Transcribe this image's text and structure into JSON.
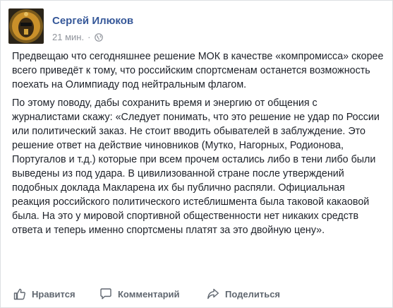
{
  "post": {
    "author": "Сергей Илюков",
    "time": "21 мин.",
    "separator": "·",
    "privacy_icon": "globe-icon",
    "paragraphs": [
      "Предвещаю что сегодняшнее решение МОК в качестве «компромисса» скорее всего приведёт к тому, что российским спортсменам останется возможность поехать на Олимпиаду под нейтральным флагом.",
      "По этому поводу, дабы сохранить время и энергию от общения с журналистами скажу: «Следует понимать, что это решение не удар по России или политический заказ. Не стоит вводить обывателей в заблуждение. Это решение ответ на действие чиновников (Мутко, Нагорных, Родионова, Португалов и т.д.) которые при всем прочем остались либо в тени либо были выведены из под удара. В цивилизованной стране после утверждений подобных доклада Макларена их бы публично распяли. Официальная реакция российского политического истеблишмента была таковой какаовой была. На это у мировой спортивной общественности нет никаких средств ответа и теперь именно спортсмены платят за это двойную цену»."
    ]
  },
  "actions": {
    "like": {
      "label": "Нравится",
      "icon": "thumbs-up-icon"
    },
    "comment": {
      "label": "Комментарий",
      "icon": "comment-icon"
    },
    "share": {
      "label": "Поделиться",
      "icon": "share-icon"
    }
  },
  "colors": {
    "author": "#365899",
    "meta": "#90949c",
    "text": "#1d2129",
    "action": "#606770"
  }
}
